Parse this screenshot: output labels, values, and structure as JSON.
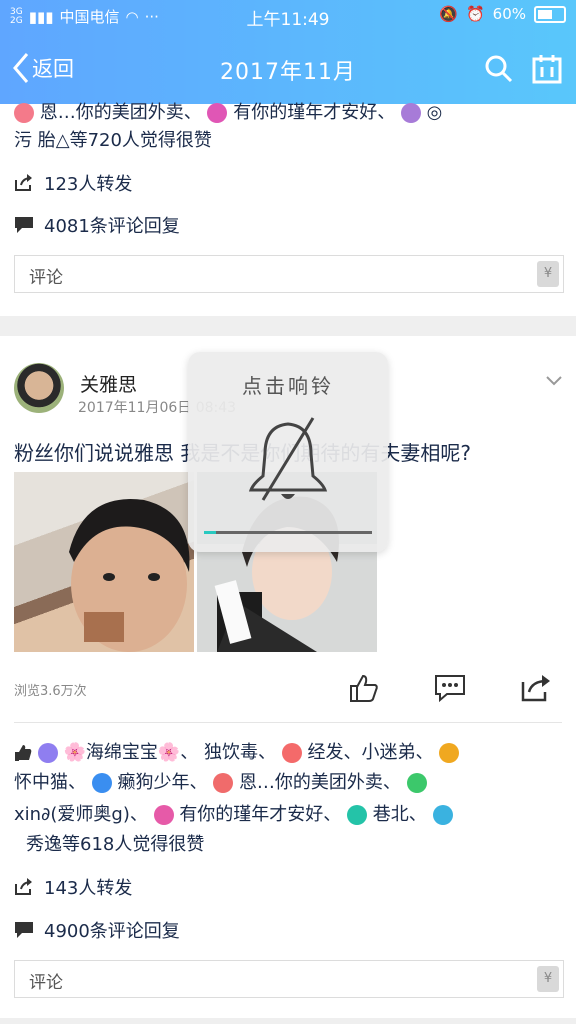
{
  "status_bar": {
    "signal_labels": [
      "3G",
      "2G"
    ],
    "carrier": "中国电信",
    "dots": "···",
    "time": "上午11:49",
    "battery": "60%"
  },
  "header": {
    "back_label": "返回",
    "title": "2017年11月"
  },
  "post1": {
    "likes_partial": [
      "恩…你的美团外卖、",
      "有你的瑾年才安好、",
      "◎",
      "污  胎△等720人觉得很赞"
    ],
    "reposts": "123人转发",
    "comments": "4081条评论回复",
    "comment_placeholder": "评论",
    "yen": "¥"
  },
  "post2": {
    "username": "关雅思",
    "time": "2017年11月06日 08:43",
    "text": "粉丝你们说说雅思 我是不是你们期待的有夫妻相呢?",
    "views": "浏览3.6万次",
    "likes_line1": "🌸海绵宝宝🌸、 独饮毒、",
    "likes_line1b": "经发、小迷弟、",
    "likes_line2a": "怀中猫、",
    "likes_line2b": "癞狗少年、",
    "likes_line2c": "恩…你的美团外卖、",
    "likes_line3a": "xin∂(爱师奥g)、",
    "likes_line3b": "有你的瑾年才安好、",
    "likes_line3c": "巷北、",
    "likes_line4": "秀逸等618人觉得很赞",
    "reposts": "143人转发",
    "comments": "4900条评论回复",
    "comment_placeholder": "评论",
    "yen": "¥"
  },
  "popup": {
    "title": "点击响铃",
    "progress": 0.07
  },
  "colors": {
    "header_start": "#5fa6ff",
    "header_end": "#59c7fb",
    "accent_progress": "#29c9c0"
  }
}
